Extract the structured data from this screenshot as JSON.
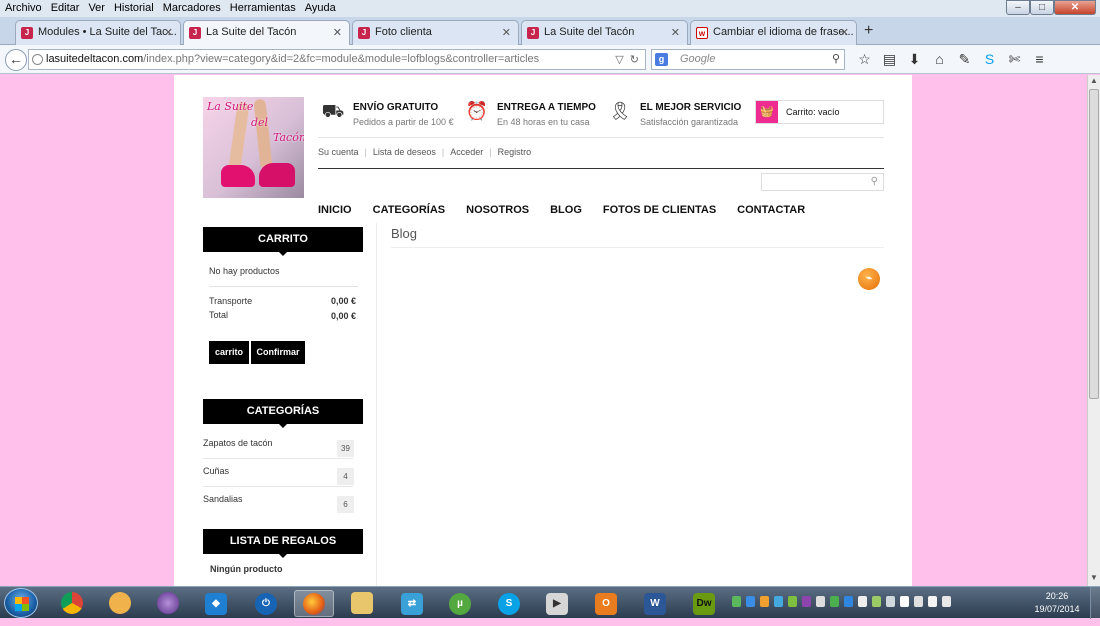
{
  "menubar": {
    "items": [
      "Archivo",
      "Editar",
      "Ver",
      "Historial",
      "Marcadores",
      "Herramientas",
      "Ayuda"
    ]
  },
  "tabs": [
    {
      "label": "Modules • La Suite del Tac...",
      "active": false
    },
    {
      "label": "La Suite del Tacón",
      "active": true
    },
    {
      "label": "Foto clienta",
      "active": false
    },
    {
      "label": "La Suite del Tacón",
      "active": false
    },
    {
      "label": "Cambiar el idioma de frase...",
      "active": false
    }
  ],
  "url": {
    "host": "lasuitedeltacon.com",
    "path": "/index.php?view=category&id=2&fc=module&module=lofblogs&controller=articles"
  },
  "search": {
    "placeholder": "Google"
  },
  "logo": {
    "line1": "La Suite",
    "line2": "del",
    "line3": "Tacón"
  },
  "features": [
    {
      "title": "ENVÍO GRATUITO",
      "subtitle": "Pedidos a partir de 100 €",
      "icon": "truck-icon"
    },
    {
      "title": "ENTREGA A TIEMPO",
      "subtitle": "En 48 horas en tu casa",
      "icon": "alarm-clock-icon"
    },
    {
      "title": "EL MEJOR SERVICIO",
      "subtitle": "Satisfacción garantizada",
      "icon": "award-icon"
    }
  ],
  "cart_header": {
    "label": "Carrito: vacío"
  },
  "account_links": [
    "Su cuenta",
    "Lista de deseos",
    "Acceder",
    "Registro"
  ],
  "main_nav": [
    "INICIO",
    "CATEGORÍAS",
    "NOSOTROS",
    "BLOG",
    "FOTOS DE CLIENTAS",
    "CONTACTAR"
  ],
  "sidebar": {
    "cart": {
      "title": "CARRITO",
      "empty": "No hay productos",
      "shipping_label": "Transporte",
      "shipping_value": "0,00 €",
      "total_label": "Total",
      "total_value": "0,00 €",
      "btn_cart": "carrito",
      "btn_confirm": "Confirmar"
    },
    "categories": {
      "title": "CATEGORÍAS",
      "items": [
        {
          "name": "Zapatos de tacón",
          "count": "39"
        },
        {
          "name": "Cuñas",
          "count": "4"
        },
        {
          "name": "Sandalias",
          "count": "6"
        }
      ]
    },
    "gifts": {
      "title": "LISTA DE REGALOS",
      "empty": "Ningún producto"
    }
  },
  "blog": {
    "title": "Blog"
  },
  "clock": {
    "time": "20:26",
    "date": "19/07/2014"
  },
  "colors": {
    "page_bg": "#ffc0eb",
    "accent": "#ee2b91",
    "dark": "#000000"
  }
}
